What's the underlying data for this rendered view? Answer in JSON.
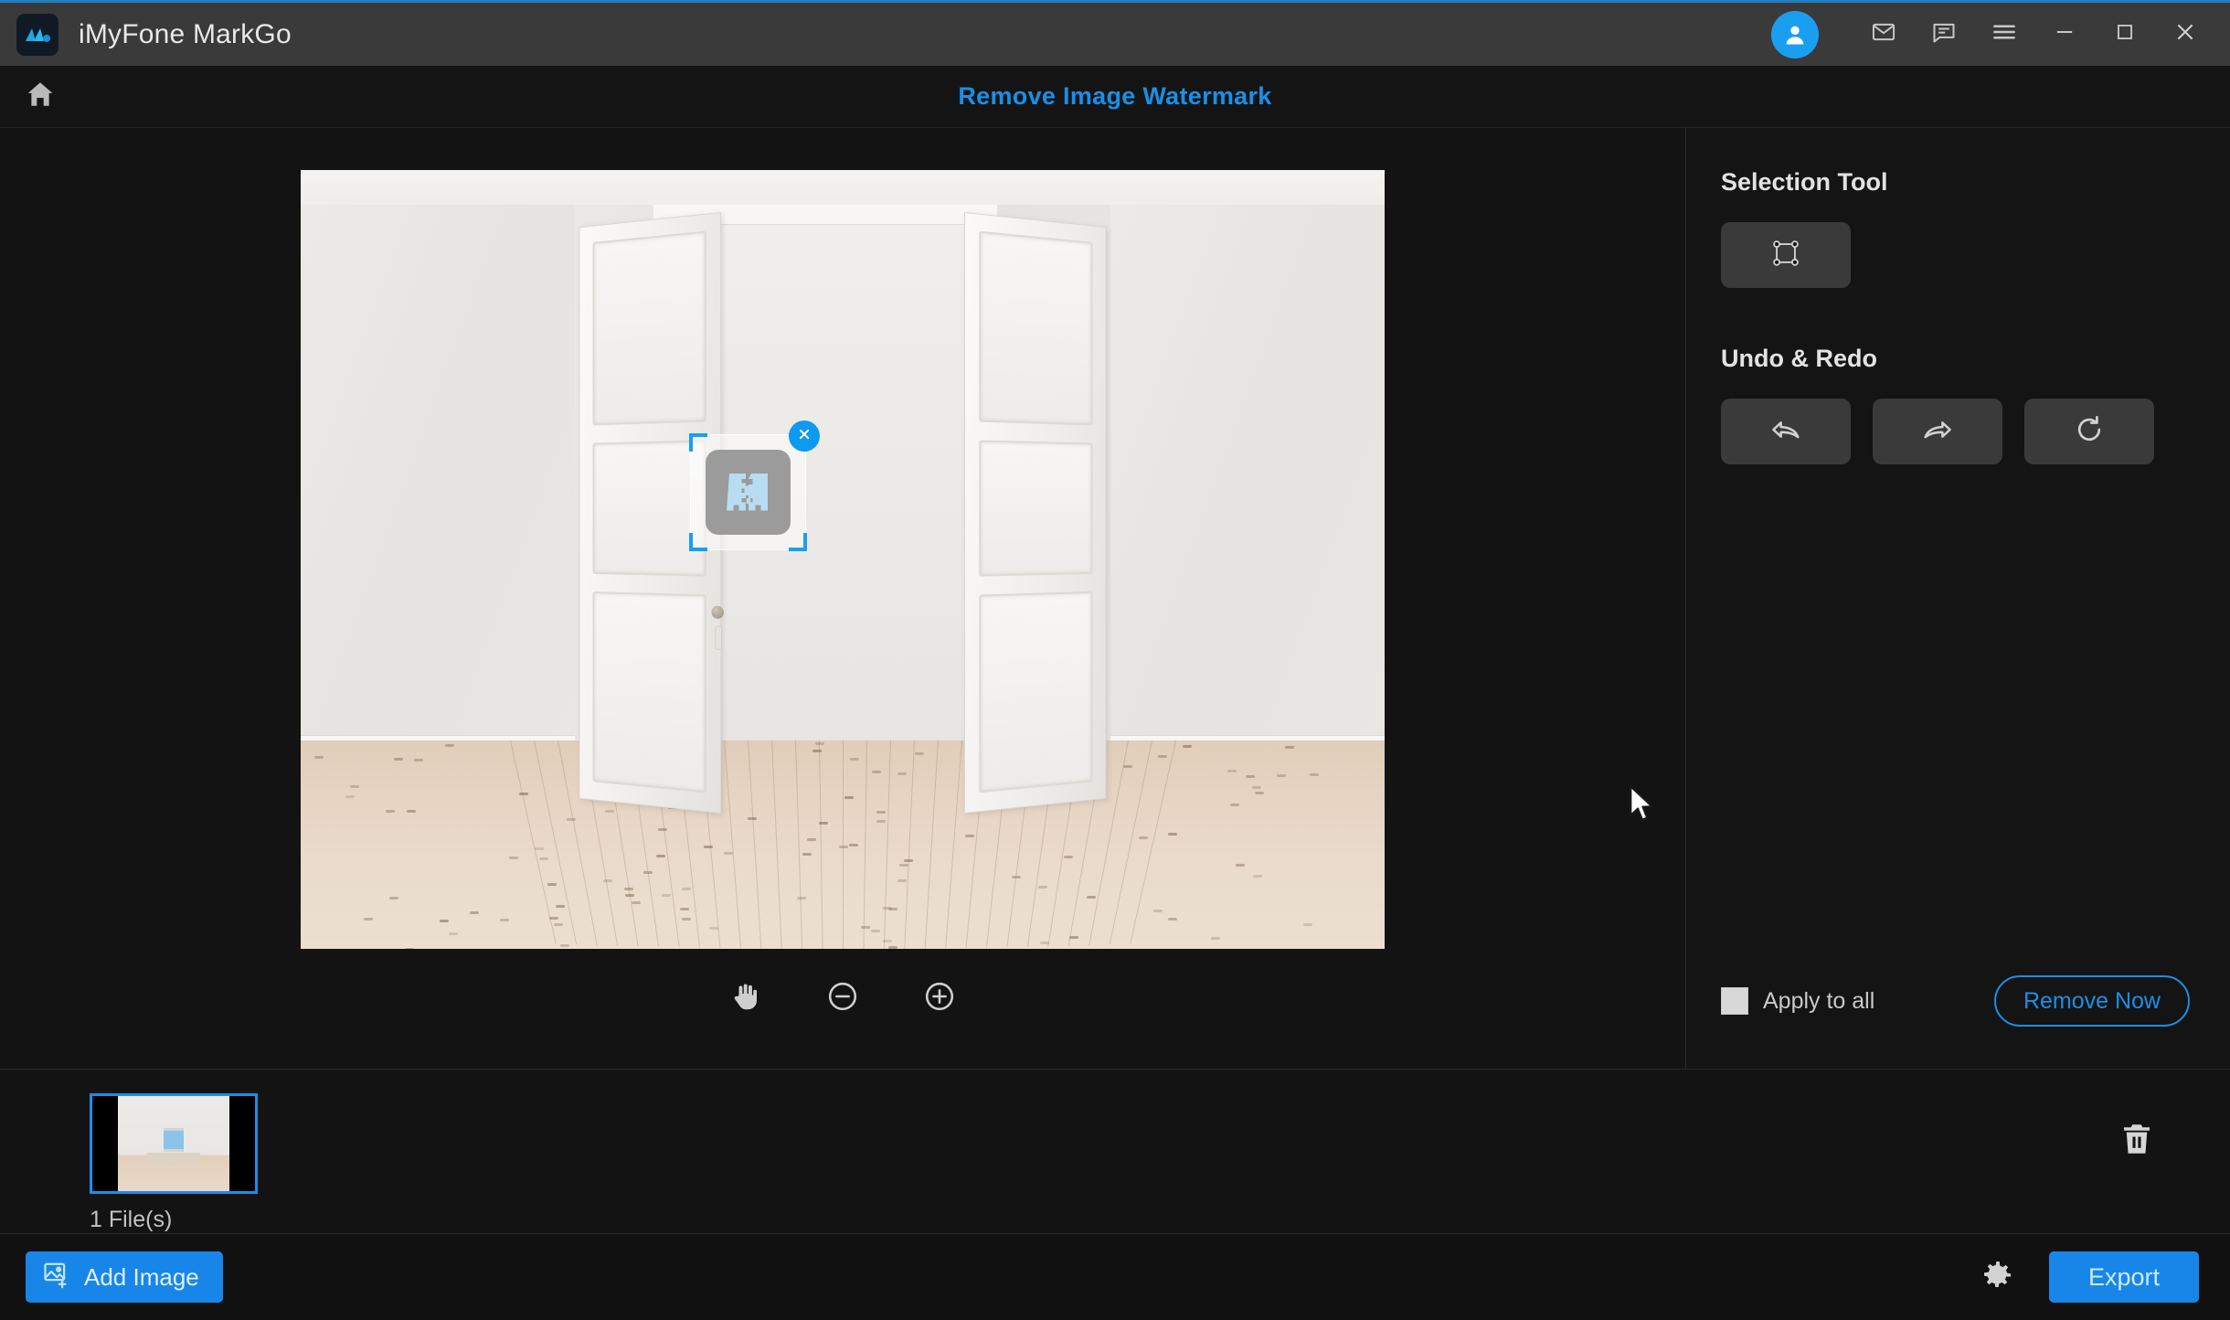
{
  "window": {
    "app_title": "iMyFone MarkGo",
    "logo_icon": "markgo-logo-icon",
    "accent_color": "#1a8fe8",
    "titlebar_bg": "#3a3a3a",
    "controls": [
      {
        "name": "account-avatar",
        "icon": "user-icon"
      },
      {
        "name": "mail-button",
        "icon": "envelope-icon"
      },
      {
        "name": "feedback-button",
        "icon": "chat-bubble-icon"
      },
      {
        "name": "menu-button",
        "icon": "hamburger-menu-icon"
      },
      {
        "name": "minimize-button",
        "icon": "minimize-icon"
      },
      {
        "name": "maximize-button",
        "icon": "maximize-icon"
      },
      {
        "name": "close-button",
        "icon": "close-icon"
      }
    ]
  },
  "header": {
    "home_icon": "home-icon",
    "title": "Remove Image Watermark"
  },
  "canvas": {
    "watermark_selection": {
      "close_icon": "close-circle-icon",
      "logo_icon": "watermark-film-logo-icon",
      "corner_handle_color": "#1a9ff0"
    },
    "cursor_icon": "mouse-pointer-icon",
    "zoom_controls": [
      {
        "name": "pan-tool-button",
        "icon": "hand-icon",
        "label": "Pan"
      },
      {
        "name": "zoom-out-button",
        "icon": "minus-circle-icon",
        "label": "Zoom Out"
      },
      {
        "name": "zoom-in-button",
        "icon": "plus-circle-icon",
        "label": "Zoom In"
      }
    ]
  },
  "sidebar": {
    "selection_tool": {
      "title": "Selection Tool",
      "buttons": [
        {
          "name": "rectangle-selection-button",
          "icon": "rectangle-select-icon"
        }
      ]
    },
    "undo_redo": {
      "title": "Undo & Redo",
      "buttons": [
        {
          "name": "undo-button",
          "icon": "undo-arrow-icon"
        },
        {
          "name": "redo-button",
          "icon": "redo-arrow-icon"
        },
        {
          "name": "reset-button",
          "icon": "refresh-circle-icon"
        }
      ]
    },
    "apply_to_all_label": "Apply to all",
    "apply_to_all_checked": false,
    "remove_now_label": "Remove Now"
  },
  "filmstrip": {
    "file_count_label": "1 File(s)",
    "thumbnails": [
      {
        "name": "thumbnail-item",
        "selected": true
      }
    ],
    "delete_icon": "trash-icon"
  },
  "bottombar": {
    "add_image_label": "Add Image",
    "add_image_icon": "image-plus-icon",
    "settings_icon": "gear-icon",
    "export_label": "Export"
  }
}
